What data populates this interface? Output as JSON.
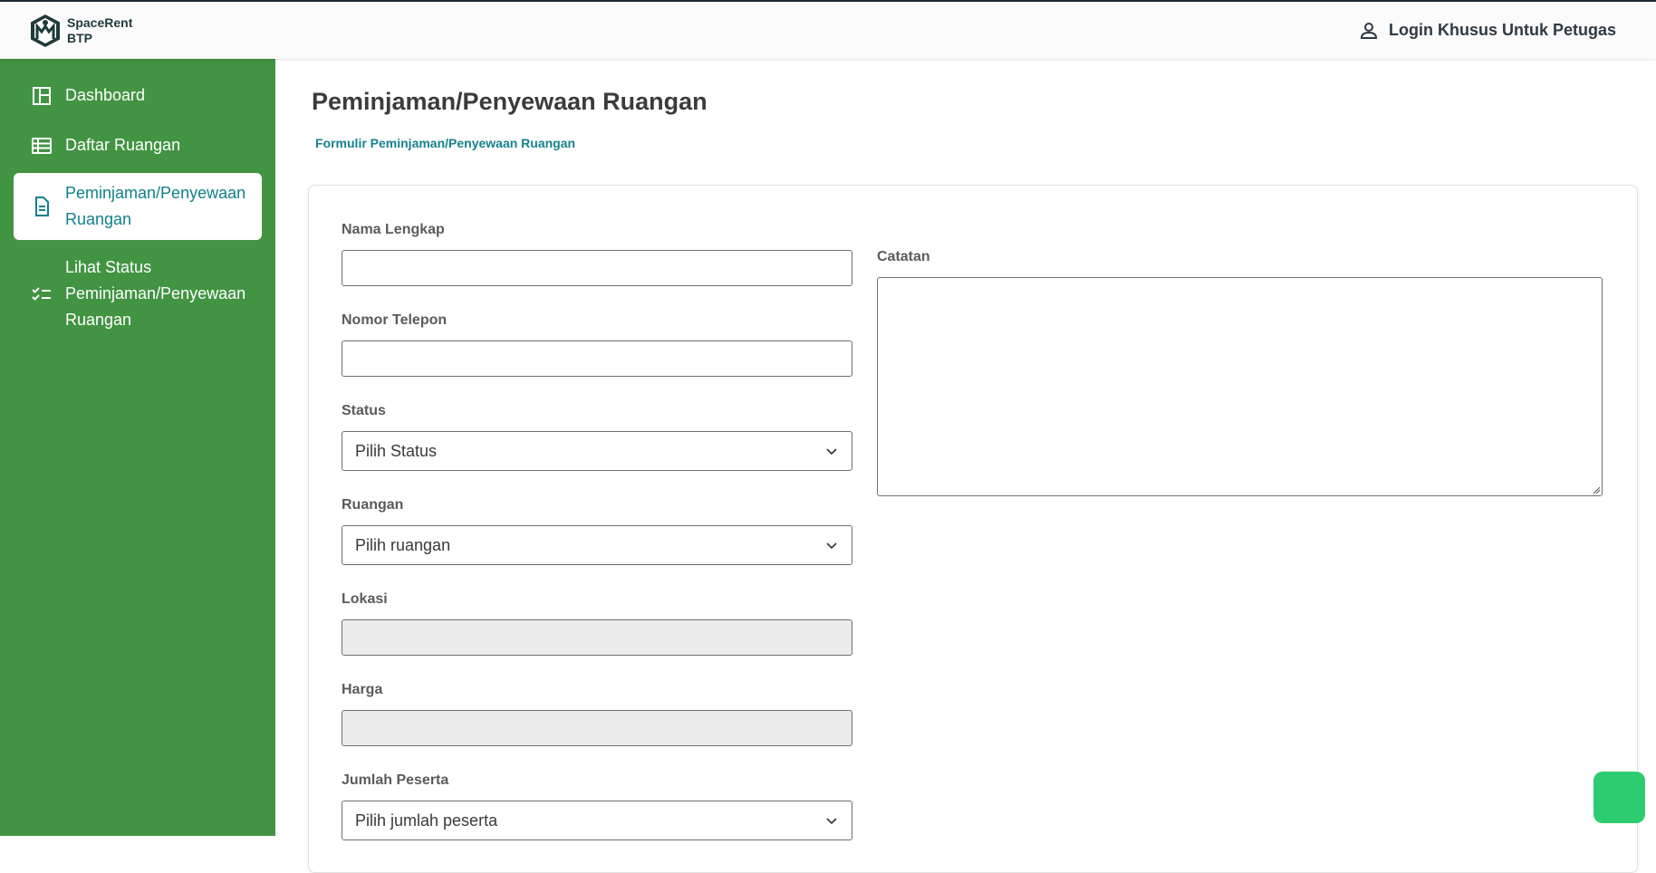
{
  "brand": {
    "name": "SpaceRent\nBTP"
  },
  "header": {
    "login_label": "Login Khusus Untuk Petugas"
  },
  "sidebar": {
    "items": [
      {
        "label": "Dashboard",
        "icon": "dashboard-icon"
      },
      {
        "label": "Daftar Ruangan",
        "icon": "table-list-icon"
      },
      {
        "label": "Peminjaman/Penyewaan Ruangan",
        "icon": "document-icon",
        "active": true
      },
      {
        "label": "Lihat Status Peminjaman/Penyewaan Ruangan",
        "icon": "checklist-icon"
      }
    ]
  },
  "page": {
    "title": "Peminjaman/Penyewaan Ruangan",
    "subtitle": "Formulir Peminjaman/Penyewaan Ruangan"
  },
  "form": {
    "nama_label": "Nama Lengkap",
    "nama_value": "",
    "telepon_label": "Nomor Telepon",
    "telepon_value": "",
    "status_label": "Status",
    "status_selected": "Pilih Status",
    "ruangan_label": "Ruangan",
    "ruangan_selected": "Pilih ruangan",
    "lokasi_label": "Lokasi",
    "lokasi_value": "",
    "harga_label": "Harga",
    "harga_value": "",
    "jumlah_label": "Jumlah Peserta",
    "jumlah_selected": "Pilih jumlah peserta",
    "catatan_label": "Catatan",
    "catatan_value": ""
  },
  "colors": {
    "sidebar_bg": "#429443",
    "accent": "#11808c",
    "fab": "#2ecc71"
  }
}
